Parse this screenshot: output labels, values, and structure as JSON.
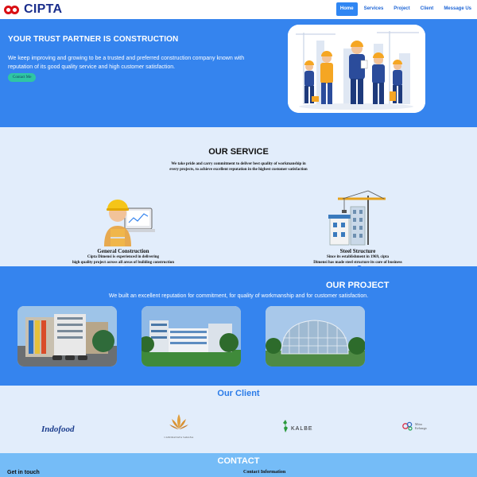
{
  "brand": {
    "name": "CIPTA",
    "logo_color": "#d90f14",
    "text_color": "#1a2e8c"
  },
  "nav": {
    "items": [
      {
        "label": "Home",
        "active": true
      },
      {
        "label": "Services",
        "active": false
      },
      {
        "label": "Project",
        "active": false
      },
      {
        "label": "Client",
        "active": false
      },
      {
        "label": "Message Us",
        "active": false
      }
    ]
  },
  "hero": {
    "title": "YOUR TRUST PARTNER IS CONSTRUCTION",
    "description": "We keep improving and growing to be a trusted and preferred construction company known with reputation of its good quality service and high customer satisfaction.",
    "button": "Contact Me",
    "image_icon": "construction-workers-illustration"
  },
  "service": {
    "title": "OUR SERVICE",
    "description": "We take pride and carry commitment to deliver best quality of workmanship in every projects, to achieve excellent reputation in the highest customer satisfaction",
    "cards": [
      {
        "name": "General Construction",
        "text_lines": [
          "Cipta Dimensi is experienced in delivering",
          "high quality project across all areas of building construction"
        ],
        "icon": "engineer-icon",
        "button": "+"
      },
      {
        "name": "Steel Structure",
        "text_lines": [
          "Since its establishment in 1969, cipta",
          "Dimensi has made steel structure its core of business"
        ],
        "icon": "crane-building-icon",
        "button": "+"
      }
    ]
  },
  "project": {
    "title": "OUR PROJECT",
    "description": "We built an excellent reputation for commitment, for quality of workmanship and for customer satisfaction.",
    "images": [
      "building-photo-1",
      "building-photo-2",
      "building-photo-3"
    ]
  },
  "client": {
    "title": "Our Client",
    "logos": [
      {
        "name": "Indofood"
      },
      {
        "name": "CANDRANAYA SARANA"
      },
      {
        "name": "KALBE"
      },
      {
        "name": "Mitra",
        "sub": "Keluarga"
      }
    ]
  },
  "contact": {
    "title": "CONTACT",
    "left_heading": "Get in touch",
    "right_heading": "Contact Information"
  },
  "colors": {
    "primary": "#3584ee",
    "light_bg": "#e2edfb",
    "accent_button": "#2fc6a3",
    "contact_bg": "#75bcf7"
  }
}
